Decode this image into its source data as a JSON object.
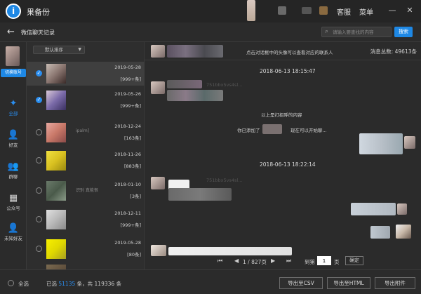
{
  "app": {
    "logo_glyph": "i",
    "title": "果备份"
  },
  "titlebar": {
    "service": "客服",
    "menu": "菜单",
    "minimize": "—",
    "close": "✕"
  },
  "header": {
    "back": "←",
    "title": "微信聊天记录",
    "search_placeholder": "请输入要查找的内容",
    "search_button": "搜索"
  },
  "sidebar": {
    "switch_account": "切换账号",
    "items": [
      {
        "icon": "✦",
        "label": "全部",
        "active": true
      },
      {
        "icon": "👤",
        "label": "好友"
      },
      {
        "icon": "👥",
        "label": "群聊"
      },
      {
        "icon": "▦",
        "label": "公众号"
      },
      {
        "icon": "👤",
        "label": "未知好友"
      }
    ]
  },
  "contacts": {
    "sort_label": "默认排序",
    "sort_arrow": "▼",
    "rows": [
      {
        "date": "2019-05-28",
        "count": "[999+条]",
        "checked": true,
        "selected": true,
        "name": ""
      },
      {
        "date": "2019-05-26",
        "count": "[999+条]",
        "checked": true,
        "name": ""
      },
      {
        "date": "2018-12-24",
        "count": "[163条]",
        "name": "ipalm]"
      },
      {
        "date": "2018-11-26",
        "count": "[883条]",
        "name": ""
      },
      {
        "date": "2018-01-10",
        "count": "[3条]",
        "name": "识别 真能恨"
      },
      {
        "date": "2018-12-11",
        "count": "[999+条]",
        "name": ""
      },
      {
        "date": "2019-05-28",
        "count": "[80条]",
        "name": ""
      },
      {
        "date": "",
        "count": "",
        "name": ""
      }
    ]
  },
  "chat": {
    "hint": "点击对话框中的头像可以查看对应的联系人",
    "total": "消息总数: 49613条",
    "timestamps": [
      "2018-06-13 18:15:47",
      "2018-06-13 18:22:14"
    ],
    "hash": "751bbx5vs4sl...",
    "system_1": "以上是打招呼的内容",
    "system_2a": "你已添加了",
    "system_2b": "现在可以开始聊...",
    "pager": {
      "first": "⏮",
      "prev": "◀",
      "page_info": "1 / 827页",
      "next": "▶",
      "last": "⏭",
      "goto": "到第",
      "page_value": "1",
      "page_unit": "页",
      "confirm": "确定"
    }
  },
  "footer": {
    "select_all": "全选",
    "selected_prefix": "已选",
    "selected_count": "51135",
    "selected_mid": "条，共",
    "total_count": "119336",
    "selected_suffix": "条",
    "export_csv": "导出至CSV",
    "export_html": "导出至HTML",
    "export_attach": "导出附件"
  }
}
